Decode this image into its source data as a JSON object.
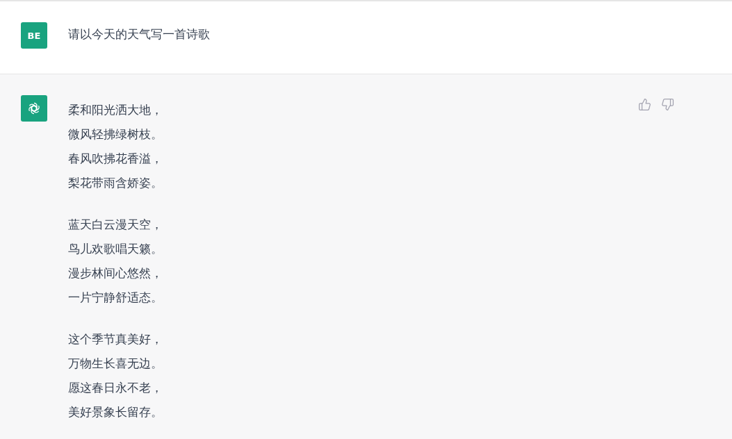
{
  "user": {
    "avatar": "BE",
    "message": "请以今天的天气写一首诗歌"
  },
  "assistant": {
    "stanzas": [
      [
        "柔和阳光洒大地，",
        "微风轻拂绿树枝。",
        "春风吹拂花香溢，",
        "梨花带雨含娇姿。"
      ],
      [
        "蓝天白云漫天空，",
        "鸟儿欢歌唱天籁。",
        "漫步林间心悠然，",
        "一片宁静舒适态。"
      ],
      [
        "这个季节真美好，",
        "万物生长喜无边。",
        "愿这春日永不老，",
        "美好景象长留存。"
      ]
    ]
  }
}
